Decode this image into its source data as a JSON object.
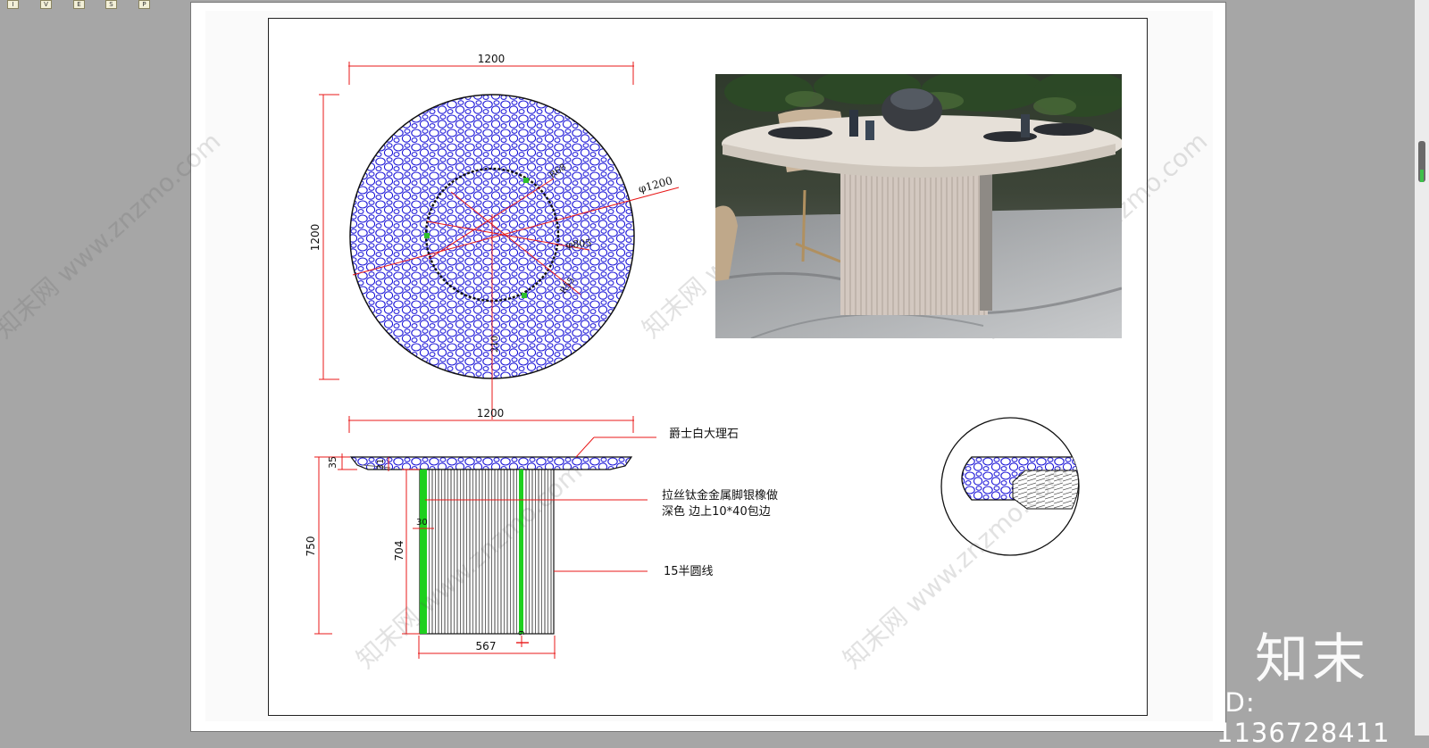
{
  "toolbar": {
    "buttons": [
      "I",
      "V",
      "E",
      "S",
      "P"
    ]
  },
  "drawing": {
    "top_view": {
      "dim_width": "1200",
      "dim_height": "1200",
      "dim_diameter": "φ1200",
      "dim_inner": "φ805",
      "dim_radius_1": "R68",
      "dim_radius_2": "R55",
      "dim_offset": "210"
    },
    "side_view": {
      "dim_width": "1200",
      "dim_total_height": "750",
      "dim_leg_height": "704",
      "dim_top_thickness": "35",
      "dim_top_edge": "31",
      "dim_border": "30",
      "dim_base_width": "567",
      "dim_small": "9"
    },
    "annotations": {
      "marble": "爵士白大理石",
      "legs_line1": "拉丝钛金金属脚银橡做",
      "legs_line2": "深色   边上10*40包边",
      "half_round": "15半圆线"
    }
  },
  "watermark": {
    "logo": "知末",
    "id": "ID: 1136728411",
    "site": "知末网 www.znzmo.com"
  },
  "colors": {
    "hatch": "#1a14d8",
    "dimension": "#e81818",
    "leg_edge": "#1ed01e",
    "background": "#a6a6a6"
  }
}
